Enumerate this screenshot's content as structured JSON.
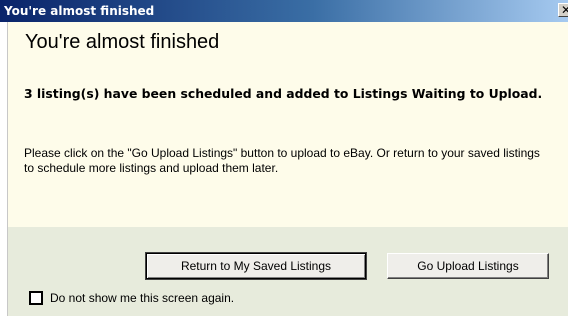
{
  "window": {
    "title": "You're almost finished",
    "close_glyph": "✕"
  },
  "content": {
    "heading": "You're almost finished",
    "bold_message": "3 listing(s) have been scheduled and added to Listings Waiting to Upload.",
    "body_message": "Please click on the \"Go Upload Listings\" button to upload to eBay.  Or return to your saved listings to schedule more listings and upload them later."
  },
  "footer": {
    "return_button_label": "Return to My Saved Listings",
    "upload_button_label": "Go Upload Listings",
    "checkbox_label": "Do not show me this screen again.",
    "checkbox_checked": false
  },
  "icons": {
    "close": "close-icon"
  },
  "colors": {
    "titlebar_start": "#0a246a",
    "titlebar_end": "#a6caf0",
    "content_bg": "#fefcea",
    "footer_bg": "#e7ebdc"
  }
}
